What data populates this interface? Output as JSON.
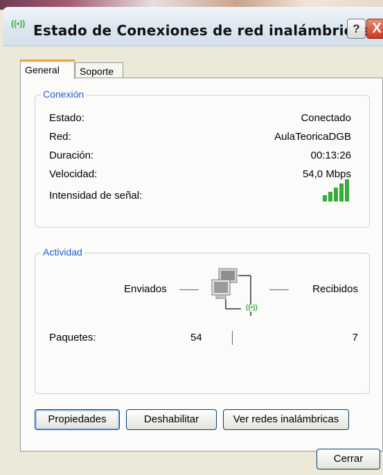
{
  "window": {
    "title": "Estado de Conexiones de red inalámbricas",
    "title_icon": "((•))"
  },
  "title_buttons": {
    "help": "?",
    "close": "X"
  },
  "tabs": [
    {
      "label": "General",
      "active": true
    },
    {
      "label": "Soporte",
      "active": false
    }
  ],
  "connection": {
    "label": "Conexión",
    "rows": [
      {
        "key": "Estado:",
        "value": "Conectado"
      },
      {
        "key": "Red:",
        "value": "AulaTeoricaDGB"
      },
      {
        "key": "Duración:",
        "value": "00:13:26"
      },
      {
        "key": "Velocidad:",
        "value": "54,0 Mbps"
      }
    ],
    "signal_label": "Intensidad de señal:",
    "signal_bars": 5
  },
  "activity": {
    "label": "Actividad",
    "sent_label": "Enviados",
    "received_label": "Recibidos",
    "packets_label": "Paquetes:",
    "packets_sent": "54",
    "packets_received": "7",
    "wireless_glyph": "((•))"
  },
  "buttons": {
    "properties": "Propiedades",
    "disable": "Deshabilitar",
    "view_networks": "Ver redes inalámbricas",
    "close": "Cerrar"
  },
  "colors": {
    "accent_label": "#1f5fd0",
    "signal": "#3aa83a",
    "tab_active": "#f0a23a"
  }
}
